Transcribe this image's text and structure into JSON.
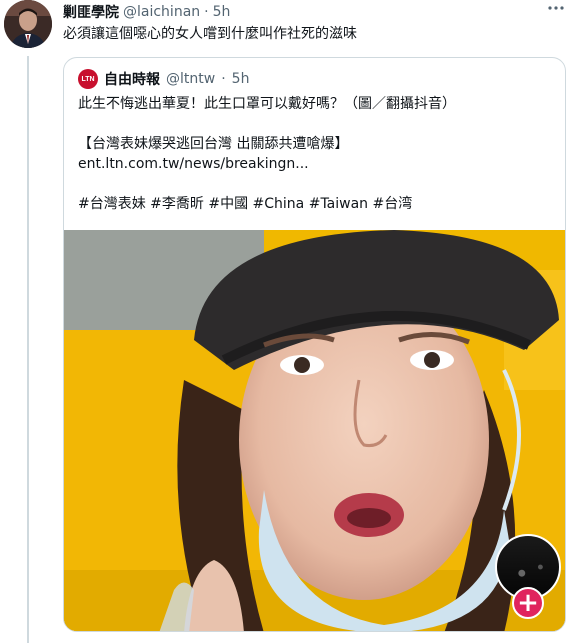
{
  "tweet": {
    "author_name": "剿匪學院",
    "author_handle": "@laichinan",
    "separator": "·",
    "time": "5h",
    "text": "必須讓這個噁心的女人嚐到什麼叫作社死的滋味",
    "more_icon": "more-dots-icon"
  },
  "quote": {
    "logo_text": "LTN",
    "author_name": "自由時報",
    "author_handle": "@ltntw",
    "separator": "·",
    "time": "5h",
    "line1": "此生不悔逃出華夏！此生口罩可以戴好嗎？（圖／翻攝抖音）",
    "line2": "【台灣表妹爆哭逃回台灣 出關舔共遭嗆爆】",
    "line3": "ent.ltn.com.tw/news/breakingn...",
    "line4": "#台灣表妹 #李喬昕 #中國 #China #Taiwan #台湾"
  },
  "colors": {
    "hashtag": "#1d9bf0",
    "plus": "#e0245e",
    "taxi_yellow": "#f2b705"
  },
  "plus_button": {
    "label": "+"
  }
}
